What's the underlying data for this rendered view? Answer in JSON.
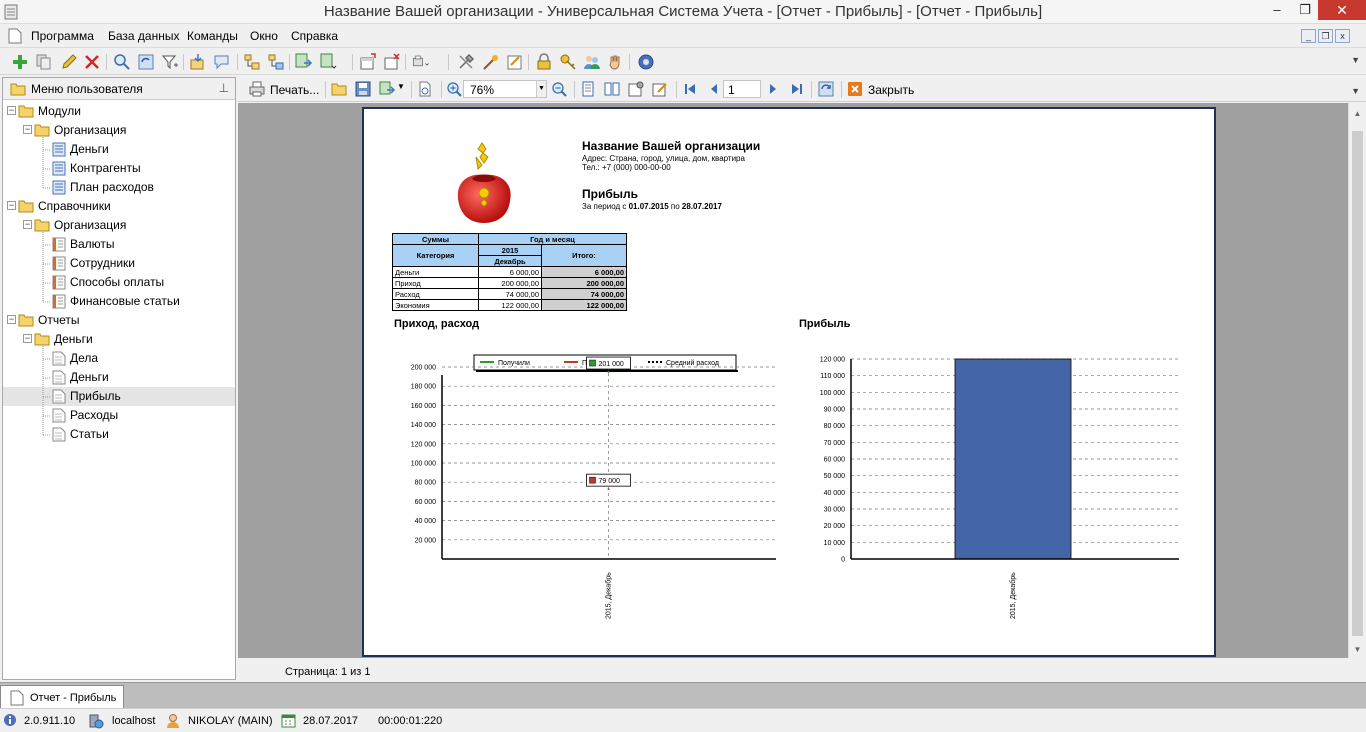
{
  "window": {
    "title": "Название Вашей организации - Универсальная Система Учета - [Отчет - Прибыль] - [Отчет - Прибыль]",
    "btn_min": "–",
    "btn_max": "❐",
    "btn_close": "✕"
  },
  "menubar": {
    "items": [
      "Программа",
      "База данных",
      "Команды",
      "Окно",
      "Справка"
    ],
    "mdi_min": "_",
    "mdi_restore": "❐",
    "mdi_close": "x"
  },
  "sidebar": {
    "title": "Меню пользователя",
    "tree": [
      {
        "label": "Модули",
        "level": 0,
        "kind": "folder",
        "toggle": "−"
      },
      {
        "label": "Организация",
        "level": 1,
        "kind": "folder",
        "toggle": "−"
      },
      {
        "label": "Деньги",
        "level": 2,
        "kind": "module"
      },
      {
        "label": "Контрагенты",
        "level": 2,
        "kind": "module"
      },
      {
        "label": "План расходов",
        "level": 2,
        "kind": "module"
      },
      {
        "label": "Справочники",
        "level": 0,
        "kind": "folder",
        "toggle": "−"
      },
      {
        "label": "Организация",
        "level": 1,
        "kind": "folder",
        "toggle": "−"
      },
      {
        "label": "Валюты",
        "level": 2,
        "kind": "ref"
      },
      {
        "label": "Сотрудники",
        "level": 2,
        "kind": "ref"
      },
      {
        "label": "Способы оплаты",
        "level": 2,
        "kind": "ref"
      },
      {
        "label": "Финансовые статьи",
        "level": 2,
        "kind": "ref"
      },
      {
        "label": "Отчеты",
        "level": 0,
        "kind": "folder",
        "toggle": "−"
      },
      {
        "label": "Деньги",
        "level": 1,
        "kind": "folder",
        "toggle": "−"
      },
      {
        "label": "Дела",
        "level": 2,
        "kind": "report"
      },
      {
        "label": "Деньги",
        "level": 2,
        "kind": "report"
      },
      {
        "label": "Прибыль",
        "level": 2,
        "kind": "report",
        "selected": true
      },
      {
        "label": "Расходы",
        "level": 2,
        "kind": "report"
      },
      {
        "label": "Статьи",
        "level": 2,
        "kind": "report"
      }
    ]
  },
  "report_toolbar": {
    "print_label": "Печать...",
    "zoom_value": "76%",
    "page_value": "1",
    "close_label": "Закрыть"
  },
  "report": {
    "org_name": "Название Вашей организации",
    "address": "Адрес: Страна, город, улица, дом, квартира",
    "phone": "Тел.: +7 (000) 000-00-00",
    "title": "Прибыль",
    "period_prefix": "За период с",
    "period_from": "01.07.2015",
    "period_mid": "по",
    "period_to": "28.07.2017",
    "table": {
      "h_sums": "Суммы",
      "h_period": "Год и месяц",
      "h_category": "Категория",
      "h_year": "2015",
      "h_month": "Декабрь",
      "h_total": "Итого:",
      "rows": [
        {
          "category": "Деньги",
          "value": "6 000,00",
          "total": "6 000,00"
        },
        {
          "category": "Приход",
          "value": "200 000,00",
          "total": "200 000,00"
        },
        {
          "category": "Расход",
          "value": "74 000,00",
          "total": "74 000,00"
        },
        {
          "category": "Экономия",
          "value": "122 000,00",
          "total": "122 000,00"
        }
      ]
    }
  },
  "chart_data": [
    {
      "type": "line",
      "title": "Приход, расход",
      "categories": [
        "2015, Декабрь"
      ],
      "series": [
        {
          "name": "Получили",
          "values": [
            201000
          ],
          "label": "201 000",
          "color": "#2e9b2e"
        },
        {
          "name": "Потратили",
          "values": [
            79000
          ],
          "label": "79 000",
          "color": "#c0392b"
        },
        {
          "name": "Средний расход",
          "values": [],
          "color": "#000000"
        }
      ],
      "ylim": [
        0,
        200000
      ],
      "yticks": [
        "20 000",
        "40 000",
        "60 000",
        "80 000",
        "100 000",
        "120 000",
        "140 000",
        "160 000",
        "180 000",
        "200 000"
      ],
      "grid": true,
      "legend": "top"
    },
    {
      "type": "bar",
      "title": "Прибыль",
      "categories": [
        "2015, Декабрь"
      ],
      "values": [
        122000
      ],
      "color": "#4566a6",
      "ylim": [
        0,
        120000
      ],
      "yticks": [
        "0",
        "10 000",
        "20 000",
        "30 000",
        "40 000",
        "50 000",
        "60 000",
        "70 000",
        "80 000",
        "90 000",
        "100 000",
        "110 000",
        "120 000"
      ],
      "grid": true
    }
  ],
  "status": {
    "page_info": "Страница: 1 из 1"
  },
  "tabs": [
    {
      "label": "Отчет - Прибыль"
    }
  ],
  "statusbar": {
    "version": "2.0.911.10",
    "host": "localhost",
    "user": "NIKOLAY (MAIN)",
    "date": "28.07.2017",
    "timer": "00:00:01:220"
  }
}
